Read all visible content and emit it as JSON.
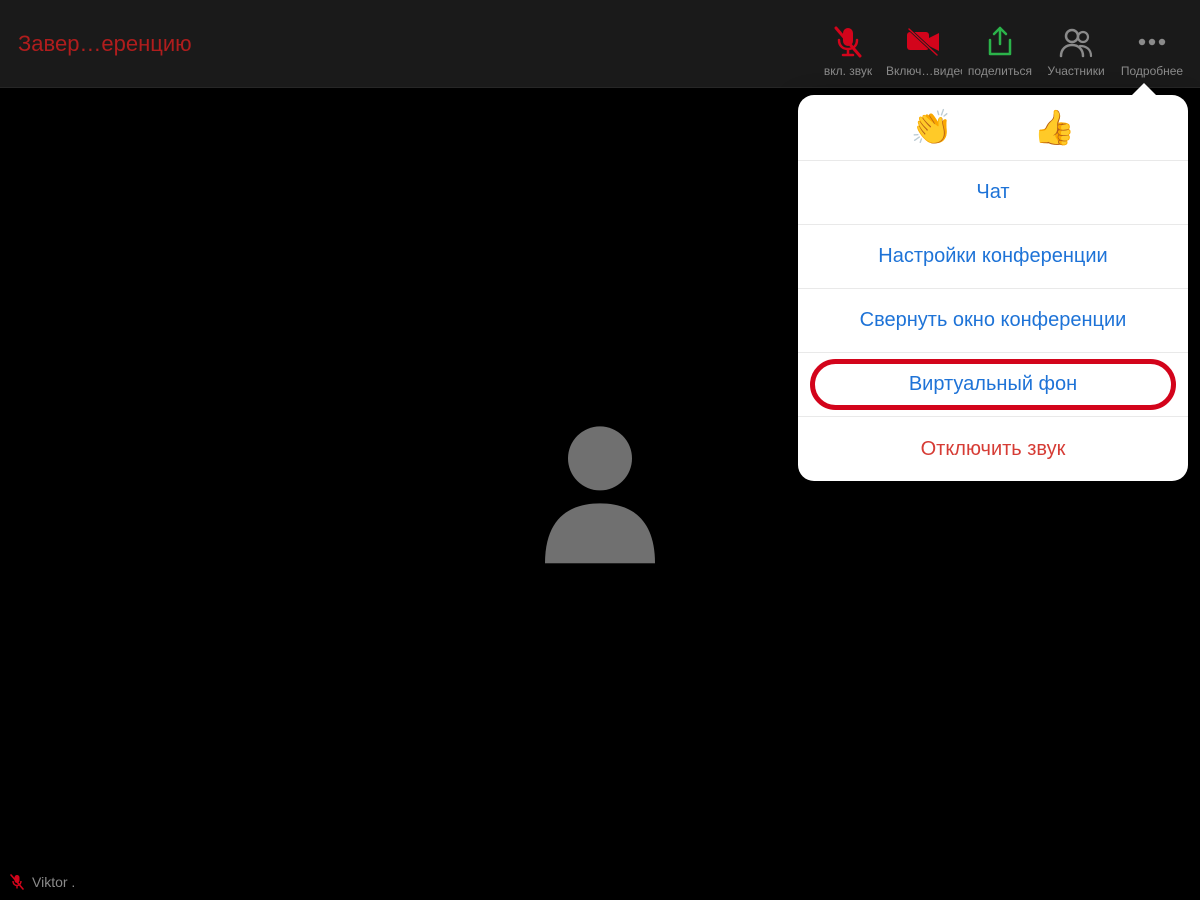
{
  "topbar": {
    "end_label": "Завер…еренцию",
    "buttons": {
      "audio": {
        "label": "вкл. звук"
      },
      "video": {
        "label": "Включ…видео"
      },
      "share": {
        "label": "поделиться"
      },
      "participants": {
        "label": "Участники"
      },
      "more": {
        "label": "Подробнее"
      }
    }
  },
  "participant": {
    "name": "Viktor ."
  },
  "popover": {
    "reactions": {
      "clap": "👏",
      "thumbs_up": "👍"
    },
    "items": {
      "chat": "Чат",
      "settings": "Настройки конференции",
      "minimize": "Свернуть окно конференции",
      "virtual_bg": "Виртуальный фон",
      "mute": "Отключить звук"
    }
  },
  "colors": {
    "link_red": "#b01d1d",
    "menu_blue": "#1e73d7",
    "menu_red": "#d63c35",
    "icon_red": "#d3041b",
    "icon_green": "#2bb34a",
    "highlight": "#d3041b"
  }
}
